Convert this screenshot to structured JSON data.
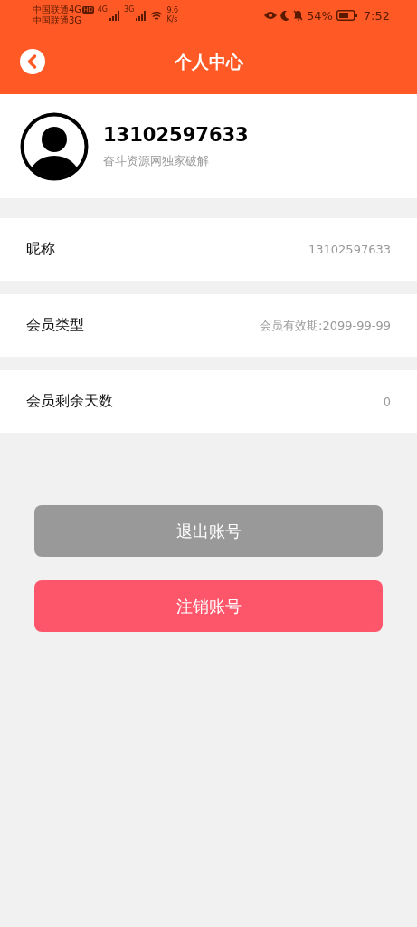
{
  "status_bar": {
    "carrier_1": "中国联通4G",
    "hd_badge": "HD",
    "carrier_2": "中国联通3G",
    "signal_1_label": "4G",
    "signal_2_label": "3G",
    "speed_value": "9.6",
    "speed_unit": "K/s",
    "battery": "54%",
    "time": "7:52"
  },
  "header": {
    "title": "个人中心"
  },
  "profile": {
    "name": "13102597633",
    "subtitle": "奋斗资源网独家破解"
  },
  "rows": [
    {
      "label": "昵称",
      "value": "13102597633"
    },
    {
      "label": "会员类型",
      "value": "会员有效期:2099-99-99"
    },
    {
      "label": "会员剩余天数",
      "value": "0"
    }
  ],
  "buttons": [
    {
      "label": "退出账号",
      "kind": "neutral"
    },
    {
      "label": "注销账号",
      "kind": "danger"
    }
  ]
}
